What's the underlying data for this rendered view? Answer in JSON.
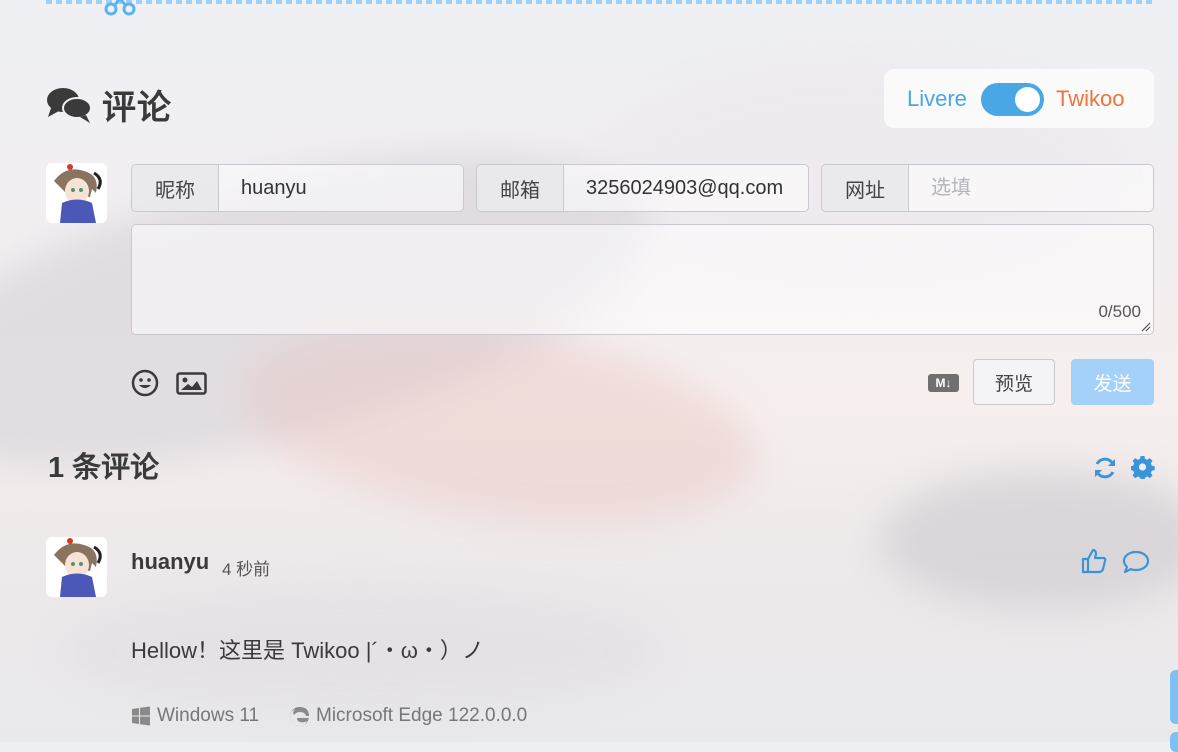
{
  "section": {
    "title": "评论"
  },
  "switcher": {
    "left_label": "Livere",
    "right_label": "Twikoo",
    "enabled": true
  },
  "form": {
    "nick_label": "昵称",
    "nick_value": "huanyu",
    "mail_label": "邮箱",
    "mail_value": "3256024903@qq.com",
    "url_label": "网址",
    "url_placeholder": "选填",
    "counter": "0/500",
    "md_badge": "M↓",
    "preview_label": "预览",
    "send_label": "发送"
  },
  "comments_header": {
    "count_text": "1 条评论"
  },
  "comments": [
    {
      "nick": "huanyu",
      "time": "4 秒前",
      "content": "Hellow！这里是 Twikoo |´・ω・）ノ",
      "os": "Windows 11",
      "browser": "Microsoft Edge 122.0.0.0"
    }
  ],
  "colors": {
    "accent": "#49a7e6",
    "twikoo": "#f0733c",
    "icon_blue": "#3b94d9",
    "send_disabled": "#a3d1fa"
  },
  "icons": [
    "scissors-icon",
    "comment-bubbles-icon",
    "emoji-icon",
    "image-icon",
    "markdown-icon",
    "refresh-icon",
    "gear-icon",
    "like-icon",
    "reply-icon",
    "windows-icon",
    "edge-icon"
  ]
}
